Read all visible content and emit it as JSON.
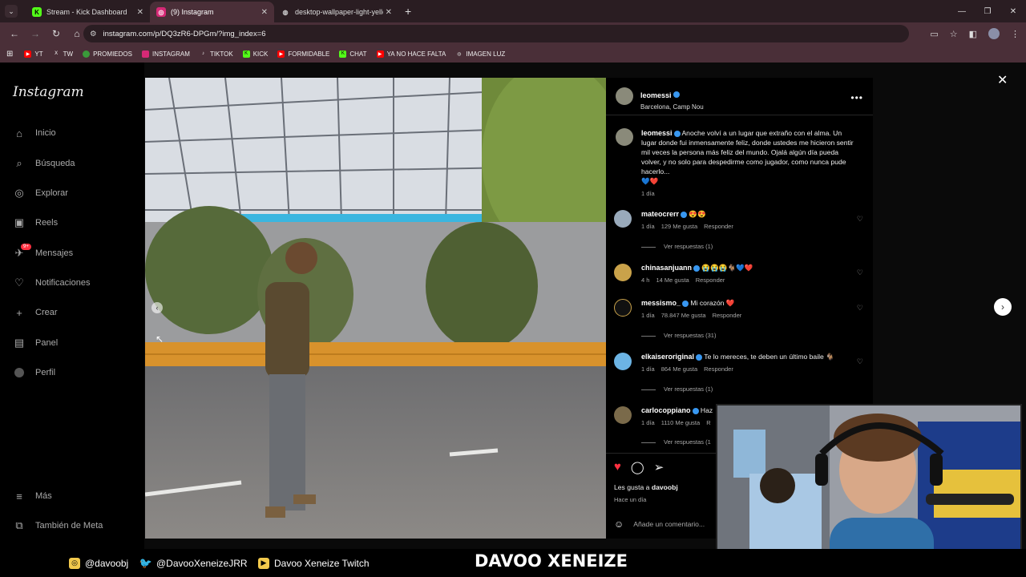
{
  "browser": {
    "tabs": [
      {
        "title": "Stream - Kick Dashboard",
        "icon": "kick-icon",
        "active": false
      },
      {
        "title": "(9) Instagram",
        "icon": "instagram-icon",
        "active": true
      },
      {
        "title": "desktop-wallpaper-light-yellow",
        "icon": "globe-icon",
        "active": false
      }
    ],
    "url": "instagram.com/p/DQ3zR6-DPGm/?img_index=6",
    "bookmarks": [
      "YT",
      "TW",
      "PROMIEDOS",
      "INSTAGRAM",
      "TIKTOK",
      "KICK",
      "FORMIDABLE",
      "CHAT",
      "YA NO HACE FALTA",
      "IMAGEN LUZ"
    ]
  },
  "sidebar": {
    "logo": "Instagram",
    "items": [
      "Inicio",
      "Búsqueda",
      "Explorar",
      "Reels",
      "Mensajes",
      "Notificaciones",
      "Crear",
      "Panel",
      "Perfil"
    ],
    "messages_badge": "9+",
    "bottom": [
      "Más",
      "También de Meta"
    ]
  },
  "post": {
    "username": "leomessi",
    "location": "Barcelona, Camp Nou",
    "caption": "Anoche volví a un lugar que extraño con el alma. Un lugar donde fui inmensamente feliz, donde ustedes me hicieron sentir mil veces la persona más feliz del mundo. Ojalá algún día pueda volver, y no solo para despedirme como jugador, como nunca pude hacerlo...",
    "caption_emoji": "💙❤️",
    "caption_time": "1 día",
    "comments": [
      {
        "user": "mateocrerr",
        "text": "😍😍",
        "time": "1 día",
        "likes": "129 Me gusta",
        "reply": "Responder",
        "replies": "Ver respuestas (1)"
      },
      {
        "user": "chinasanjuann",
        "text": "😭😭😭🐐💙❤️",
        "time": "4 h",
        "likes": "14 Me gusta",
        "reply": "Responder",
        "replies": ""
      },
      {
        "user": "messismo_",
        "text": "Mi corazón ❤️",
        "time": "1 día",
        "likes": "78.847 Me gusta",
        "reply": "Responder",
        "replies": "Ver respuestas (31)"
      },
      {
        "user": "elkaiseroriginal",
        "text": "Te lo mereces, te deben un último baile 🐐",
        "time": "1 día",
        "likes": "864 Me gusta",
        "reply": "Responder",
        "replies": "Ver respuestas (1)"
      },
      {
        "user": "carlocoppiano",
        "text": "Haz",
        "time": "1 día",
        "likes": "1110 Me gusta",
        "reply": "R",
        "replies": "Ver respuestas (1"
      }
    ],
    "liked_by": "Les gusta a",
    "liked_by_user": "davoobj",
    "posted_ago": "Hace un día",
    "add_comment_placeholder": "Añade un comentario..."
  },
  "stream_overlay": {
    "instagram": "@davoobj",
    "twitter": "@DavooXeneizeJRR",
    "youtube": "Davoo Xeneize Twitch",
    "brand": "DAVOO XENEIZE"
  },
  "colors": {
    "like": "#ff3040",
    "verified": "#3897f0",
    "browser_bg": "#4a2f38"
  }
}
